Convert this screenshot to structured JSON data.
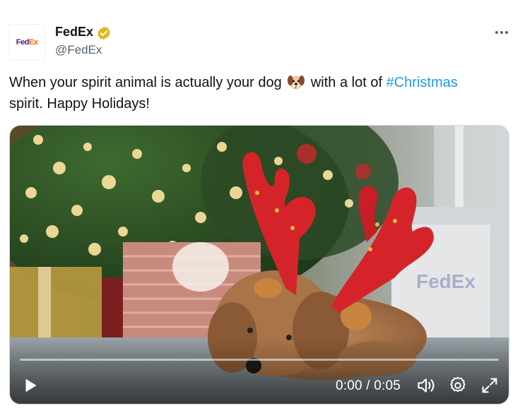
{
  "author": {
    "name": "FedEx",
    "handle": "@FedEx",
    "avatar_text_part1": "Fed",
    "avatar_text_part2": "Ex",
    "verified_badge_color": "#e2b719"
  },
  "tweet": {
    "text_part1": "When your spirit animal is actually your dog",
    "text_part2": "with a lot of",
    "hashtag": "#Christmas",
    "text_part3": "spirit. Happy Holidays!"
  },
  "video": {
    "time_display": "0:00 / 0:05",
    "progress": 0,
    "box_logo_text": "FedEx"
  },
  "colors": {
    "text": "#0f1419",
    "secondary": "#536471",
    "link": "#1d9bf0"
  },
  "icons": [
    "more-options-icon",
    "verified-badge-icon",
    "dog-emoji-icon",
    "play-icon",
    "volume-icon",
    "settings-icon",
    "fullscreen-icon"
  ]
}
